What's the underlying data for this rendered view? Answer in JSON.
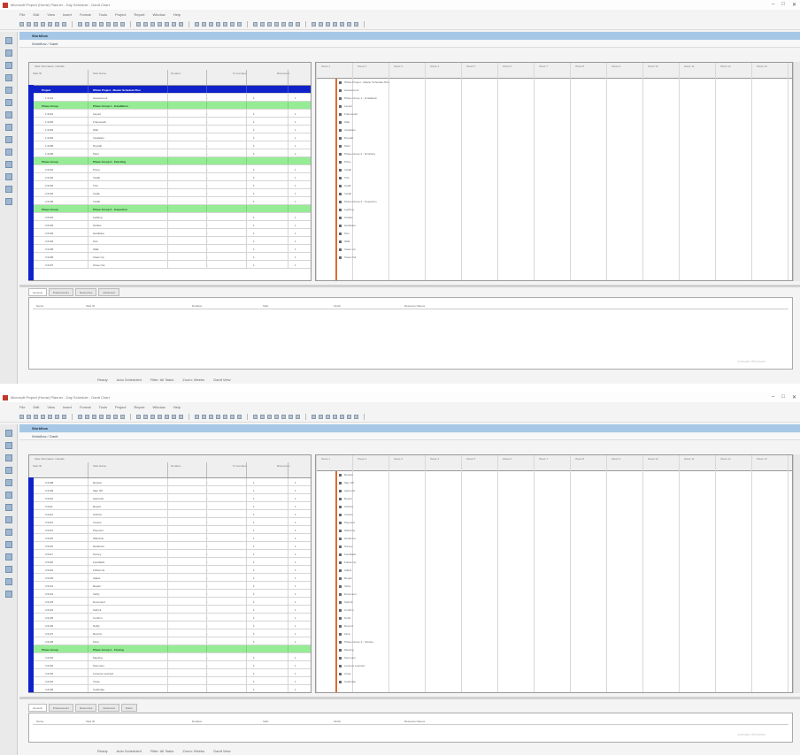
{
  "window1": {
    "title": "Microsoft Project (Home) Planner - Day Schedule - Gantt Chart",
    "menu": [
      "File",
      "Edit",
      "View",
      "Insert",
      "Format",
      "Tools",
      "Project",
      "Report",
      "Window",
      "Help"
    ],
    "header": "Workflow",
    "subheader": "Workflow / Gantt",
    "grid_columns": {
      "group_label": "Task Information / Details",
      "id": "Task ID",
      "name": "Task Name",
      "duration": "Duration",
      "percent": "% Complete",
      "resources": "Resources"
    },
    "rows": [
      {
        "kind": "project",
        "id": "Project",
        "name": "Whole Project - Master Schedule Plan"
      },
      {
        "kind": "task",
        "id": "1 0101",
        "name": "Assessment",
        "dur": "1",
        "pct": "1",
        "num": "1"
      },
      {
        "kind": "group",
        "id": "Phase Group",
        "name": "Phase Group 1 - Installation"
      },
      {
        "kind": "task",
        "id": "1 0201",
        "name": "Layout",
        "dur": "1",
        "pct": "1",
        "num": "1"
      },
      {
        "kind": "task",
        "id": "1 0202",
        "name": "Framework",
        "dur": "1",
        "pct": "1",
        "num": "1"
      },
      {
        "kind": "task",
        "id": "1 0203",
        "name": "Wall",
        "dur": "1",
        "pct": "1",
        "num": "1"
      },
      {
        "kind": "task",
        "id": "1 0204",
        "name": "Insulation",
        "dur": "1",
        "pct": "1",
        "num": "1"
      },
      {
        "kind": "task",
        "id": "1 0205",
        "name": "Drywall",
        "dur": "1",
        "pct": "1",
        "num": "1"
      },
      {
        "kind": "task",
        "id": "1 0206",
        "name": "Paint",
        "dur": "1",
        "pct": "1",
        "num": "1"
      },
      {
        "kind": "group",
        "id": "Phase Group",
        "name": "Phase Group 2 - Finishing"
      },
      {
        "kind": "task",
        "id": "2 0101",
        "name": "Prime",
        "dur": "1",
        "pct": "1",
        "num": "1"
      },
      {
        "kind": "task",
        "id": "2 0102",
        "name": "Install",
        "dur": "1",
        "pct": "1",
        "num": "1"
      },
      {
        "kind": "task",
        "id": "2 0103",
        "name": "Trim",
        "dur": "1",
        "pct": "1",
        "num": "1"
      },
      {
        "kind": "task",
        "id": "2 0104",
        "name": "Caulk",
        "dur": "1",
        "pct": "1",
        "num": "1"
      },
      {
        "kind": "task",
        "id": "2 0105",
        "name": "Install",
        "dur": "1",
        "pct": "1",
        "num": "1"
      },
      {
        "kind": "group",
        "id": "Phase Group",
        "name": "Phase Group 3 - Inspection"
      },
      {
        "kind": "task",
        "id": "3 0101",
        "name": "Lighting",
        "dur": "1",
        "pct": "1",
        "num": "1"
      },
      {
        "kind": "task",
        "id": "3 0102",
        "name": "Outlets",
        "dur": "1",
        "pct": "1",
        "num": "1"
      },
      {
        "kind": "task",
        "id": "3 0103",
        "name": "Hardware",
        "dur": "1",
        "pct": "1",
        "num": "1"
      },
      {
        "kind": "task",
        "id": "3 0104",
        "name": "Test",
        "dur": "1",
        "pct": "1",
        "num": "1"
      },
      {
        "kind": "task",
        "id": "3 0105",
        "name": "Walk",
        "dur": "1",
        "pct": "1",
        "num": "1"
      },
      {
        "kind": "task",
        "id": "3 0106",
        "name": "Clean Up",
        "dur": "1",
        "pct": "1",
        "num": "1"
      },
      {
        "kind": "task",
        "id": "3 0107",
        "name": "Close Out",
        "dur": "1",
        "pct": "1",
        "num": "1"
      }
    ],
    "gantt_weeks": [
      "Week 1",
      "Week 2",
      "Week 3",
      "Week 4",
      "Week 5",
      "Week 6",
      "Week 7",
      "Week 8",
      "Week 9",
      "Week 10",
      "Week 11",
      "Week 12",
      "Week 13"
    ],
    "gantt_labels": [
      "Whole Project - Master Schedule Plan",
      "Assessment",
      "Phase Group 1 - Installation",
      "Layout",
      "Framework",
      "Wall",
      "Insulation",
      "Drywall",
      "Paint",
      "Phase Group 2 - Finishing",
      "Prime",
      "Install",
      "Trim",
      "Caulk",
      "Install",
      "Phase Group 3 - Inspection",
      "Lighting",
      "Outlets",
      "Hardware",
      "Test",
      "Walk",
      "Clean Up",
      "Close Out"
    ],
    "detail_tabs": [
      "General",
      "Predecessors",
      "Resources",
      "Advanced"
    ],
    "detail_fields": [
      "Name:",
      "Task ID",
      "Duration",
      "Start",
      "Finish",
      "Resource Names"
    ],
    "watermark": "Activate Windows",
    "status": [
      "Ready",
      "Auto Scheduled",
      "Filter: All Tasks",
      "Zoom: Weeks",
      "Gantt View"
    ]
  },
  "window2": {
    "title": "Microsoft Project (Home) Planner - Day Schedule - Gantt Chart",
    "menu": [
      "File",
      "Edit",
      "View",
      "Insert",
      "Format",
      "Tools",
      "Project",
      "Report",
      "Window",
      "Help"
    ],
    "header": "Workflow",
    "subheader": "Workflow / Gantt",
    "rows": [
      {
        "kind": "task",
        "id": "3 0108",
        "name": "Review",
        "dur": "1",
        "pct": "1",
        "num": "1"
      },
      {
        "kind": "task",
        "id": "3 0109",
        "name": "Sign Off",
        "dur": "1",
        "pct": "1",
        "num": "1"
      },
      {
        "kind": "task",
        "id": "3 0110",
        "name": "Approval",
        "dur": "1",
        "pct": "1",
        "num": "1"
      },
      {
        "kind": "task",
        "id": "3 0111",
        "name": "Report",
        "dur": "1",
        "pct": "1",
        "num": "1"
      },
      {
        "kind": "task",
        "id": "3 0112",
        "name": "Archive",
        "dur": "1",
        "pct": "1",
        "num": "1"
      },
      {
        "kind": "task",
        "id": "3 0113",
        "name": "Invoice",
        "dur": "1",
        "pct": "1",
        "num": "1"
      },
      {
        "kind": "task",
        "id": "3 0114",
        "name": "Payment",
        "dur": "1",
        "pct": "1",
        "num": "1"
      },
      {
        "kind": "task",
        "id": "3 0115",
        "name": "Warranty",
        "dur": "1",
        "pct": "1",
        "num": "1"
      },
      {
        "kind": "task",
        "id": "3 0116",
        "name": "Handover",
        "dur": "1",
        "pct": "1",
        "num": "1"
      },
      {
        "kind": "task",
        "id": "3 0117",
        "name": "Survey",
        "dur": "1",
        "pct": "1",
        "num": "1"
      },
      {
        "kind": "task",
        "id": "3 0118",
        "name": "Feedback",
        "dur": "1",
        "pct": "1",
        "num": "1"
      },
      {
        "kind": "task",
        "id": "3 0119",
        "name": "Follow Up",
        "dur": "1",
        "pct": "1",
        "num": "1"
      },
      {
        "kind": "task",
        "id": "3 0120",
        "name": "Adjust",
        "dur": "1",
        "pct": "1",
        "num": "1"
      },
      {
        "kind": "task",
        "id": "3 0121",
        "name": "Repair",
        "dur": "1",
        "pct": "1",
        "num": "1"
      },
      {
        "kind": "task",
        "id": "3 0122",
        "name": "Verify",
        "dur": "1",
        "pct": "1",
        "num": "1"
      },
      {
        "kind": "task",
        "id": "3 0123",
        "name": "Document",
        "dur": "1",
        "pct": "1",
        "num": "1"
      },
      {
        "kind": "task",
        "id": "3 0124",
        "name": "Submit",
        "dur": "1",
        "pct": "1",
        "num": "1"
      },
      {
        "kind": "task",
        "id": "3 0125",
        "name": "Confirm",
        "dur": "1",
        "pct": "1",
        "num": "1"
      },
      {
        "kind": "task",
        "id": "3 0126",
        "name": "Notify",
        "dur": "1",
        "pct": "1",
        "num": "1"
      },
      {
        "kind": "task",
        "id": "3 0127",
        "name": "Record",
        "dur": "1",
        "pct": "1",
        "num": "1"
      },
      {
        "kind": "task",
        "id": "3 0128",
        "name": "Final",
        "dur": "1",
        "pct": "1",
        "num": "1"
      },
      {
        "kind": "group",
        "id": "Phase Group",
        "name": "Phase Group 4 - Closing"
      },
      {
        "kind": "task",
        "id": "4 0101",
        "name": "Meeting",
        "dur": "1",
        "pct": "1",
        "num": "1"
      },
      {
        "kind": "task",
        "id": "4 0102",
        "name": "Summary",
        "dur": "1",
        "pct": "1",
        "num": "1"
      },
      {
        "kind": "task",
        "id": "4 0103",
        "name": "Lessons Learned",
        "dur": "1",
        "pct": "1",
        "num": "1"
      },
      {
        "kind": "task",
        "id": "4 0104",
        "name": "Close",
        "dur": "1",
        "pct": "1",
        "num": "1"
      },
      {
        "kind": "task",
        "id": "4 0105",
        "name": "Celebrate",
        "dur": "1",
        "pct": "1",
        "num": "1"
      }
    ],
    "gantt_weeks": [
      "Week 1",
      "Week 2",
      "Week 3",
      "Week 4",
      "Week 5",
      "Week 6",
      "Week 7",
      "Week 8",
      "Week 9",
      "Week 10",
      "Week 11",
      "Week 12",
      "Week 13"
    ],
    "gantt_labels": [
      "Review",
      "Sign Off",
      "Approval",
      "Report",
      "Archive",
      "Invoice",
      "Payment",
      "Warranty",
      "Handover",
      "Survey",
      "Feedback",
      "Follow Up",
      "Adjust",
      "Repair",
      "Verify",
      "Document",
      "Submit",
      "Confirm",
      "Notify",
      "Record",
      "Final",
      "Phase Group 4 - Closing",
      "Meeting",
      "Summary",
      "Lessons Learned",
      "Close",
      "Celebrate"
    ],
    "detail_tabs": [
      "General",
      "Predecessors",
      "Resources",
      "Advanced",
      "Notes"
    ],
    "detail_fields": [
      "Name:",
      "Task ID",
      "Duration",
      "Start",
      "Finish",
      "Resource Names"
    ],
    "watermark": "Activate Windows",
    "status": [
      "Ready",
      "Auto Scheduled",
      "Filter: All Tasks",
      "Zoom: Weeks",
      "Gantt View"
    ]
  }
}
